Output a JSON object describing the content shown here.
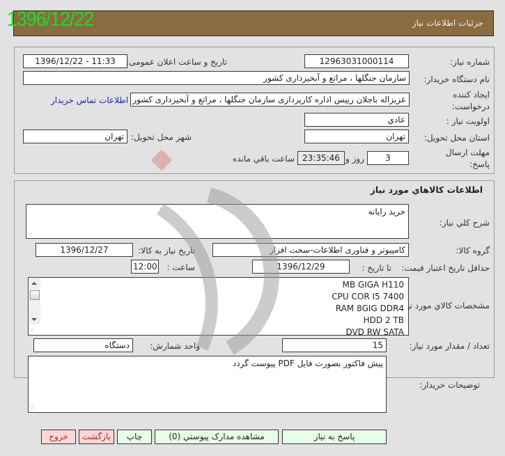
{
  "header": {
    "title": "جزئيات اطلاعات نياز",
    "date_stamp": "1396/12/22"
  },
  "general": {
    "need_number_label": "شماره نياز:",
    "need_number": "12963031000114",
    "announce_label": "تاريخ و ساعت اعلان عمومی:",
    "announce_value": "1396/12/22 - 11:33",
    "buyer_org_label": "نام دستگاه خريدار:",
    "buyer_org": "سازمان جنگلها ، مراتع و آبخيزداری کشور",
    "creator_label": "ايجاد کننده درخواست:",
    "creator": "عزيزاله باجلان رييس اداره کارپردازی سازمان جنگلها ، مراتع و آبخيزداری کشور",
    "buyer_contact_link": "اطلاعات تماس خريدار",
    "priority_label": "اولويت نياز :",
    "priority": "عادي",
    "province_label": "استان محل تحويل:",
    "province": "تهران",
    "city_label": "شهر محل تحويل:",
    "city": "تهران",
    "deadline_label": "مهلت ارسال پاسخ:",
    "deadline_days": "3",
    "days_and": "روز و",
    "deadline_time": "23:35:46",
    "remaining_label": "ساعت باقي مانده"
  },
  "goods": {
    "section_title": "اطلاعات کالاهاي مورد نياز",
    "description_label": "شرح کلي نياز:",
    "description": "خريد رايانه",
    "group_label": "گروه کالا:",
    "group": "کامپيوتر و فناوری اطلاعات-سخت افزار",
    "need_date_label": "تاريخ نياز به کالا:",
    "need_date": "1396/12/27",
    "price_validity_label": "حداقل تاريخ اعتبار قيمت:",
    "until_date_label": "تا تاريخ :",
    "until_date": "1396/12/29",
    "time_label": "ساعت :",
    "time": "12:00",
    "specs_label": "مشخصات کالاي مورد نياز:",
    "specs": [
      "MB GIGA H110",
      "CPU COR I5 7400",
      "RAM 8GIG DDR4",
      "HDD 2 TB",
      "DVD RW SATA"
    ],
    "quantity_label": "تعداد / مقدار مورد نياز:",
    "quantity": "15",
    "unit_label": "واحد شمارش:",
    "unit": "دستگاه",
    "buyer_notes_label": "توضيحات خريدار:",
    "buyer_notes": "پيش فاکتور بصورت فايل PDF پيوست گردد"
  },
  "actions": {
    "respond": "پاسخ به نياز",
    "view_attachments": "مشاهده مدارک پيوستي (0)",
    "print": "چاپ",
    "back": "بازگشت",
    "exit": "خروج"
  }
}
